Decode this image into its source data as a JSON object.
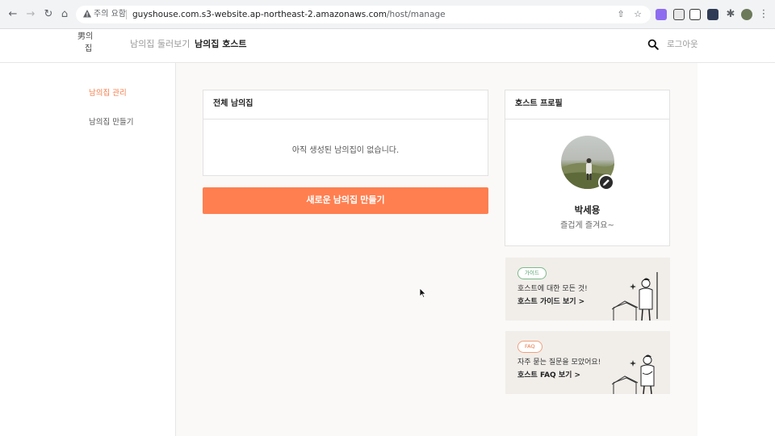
{
  "browser": {
    "security_warning": "주의 요함",
    "url_domain": "guyshouse.com.s3-website.ap-northeast-2.amazonaws.com",
    "url_path": "/host/manage"
  },
  "header": {
    "logo_lines": [
      "男의",
      "집"
    ],
    "nav": [
      {
        "label": "남의집 둘러보기",
        "active": false
      },
      {
        "label": "남의집 호스트",
        "active": true
      }
    ],
    "logout_label": "로그아웃"
  },
  "sidebar": {
    "items": [
      {
        "label": "남의집 관리",
        "active": true
      },
      {
        "label": "남의집 만들기",
        "active": false
      }
    ]
  },
  "houses_card": {
    "title": "전체 남의집",
    "empty_message": "아직 생성된 남의집이 없습니다."
  },
  "create_button_label": "새로운 남의집 만들기",
  "profile_card": {
    "title": "호스트 프로필",
    "name": "박세용",
    "bio": "즐겁게 즐겨요~"
  },
  "banners": [
    {
      "badge": "가이드",
      "line1": "호스트에 대한 모든 것!",
      "line2": "호스트 가이드 보기 >",
      "badge_color": "#4f9b63"
    },
    {
      "badge": "FAQ",
      "line1": "자주 묻는 질문을 모았어요!",
      "line2": "호스트 FAQ 보기 >",
      "badge_color": "#e57845"
    }
  ],
  "colors": {
    "accent": "#ff7f50",
    "sidebar_active": "#f57c4a"
  }
}
